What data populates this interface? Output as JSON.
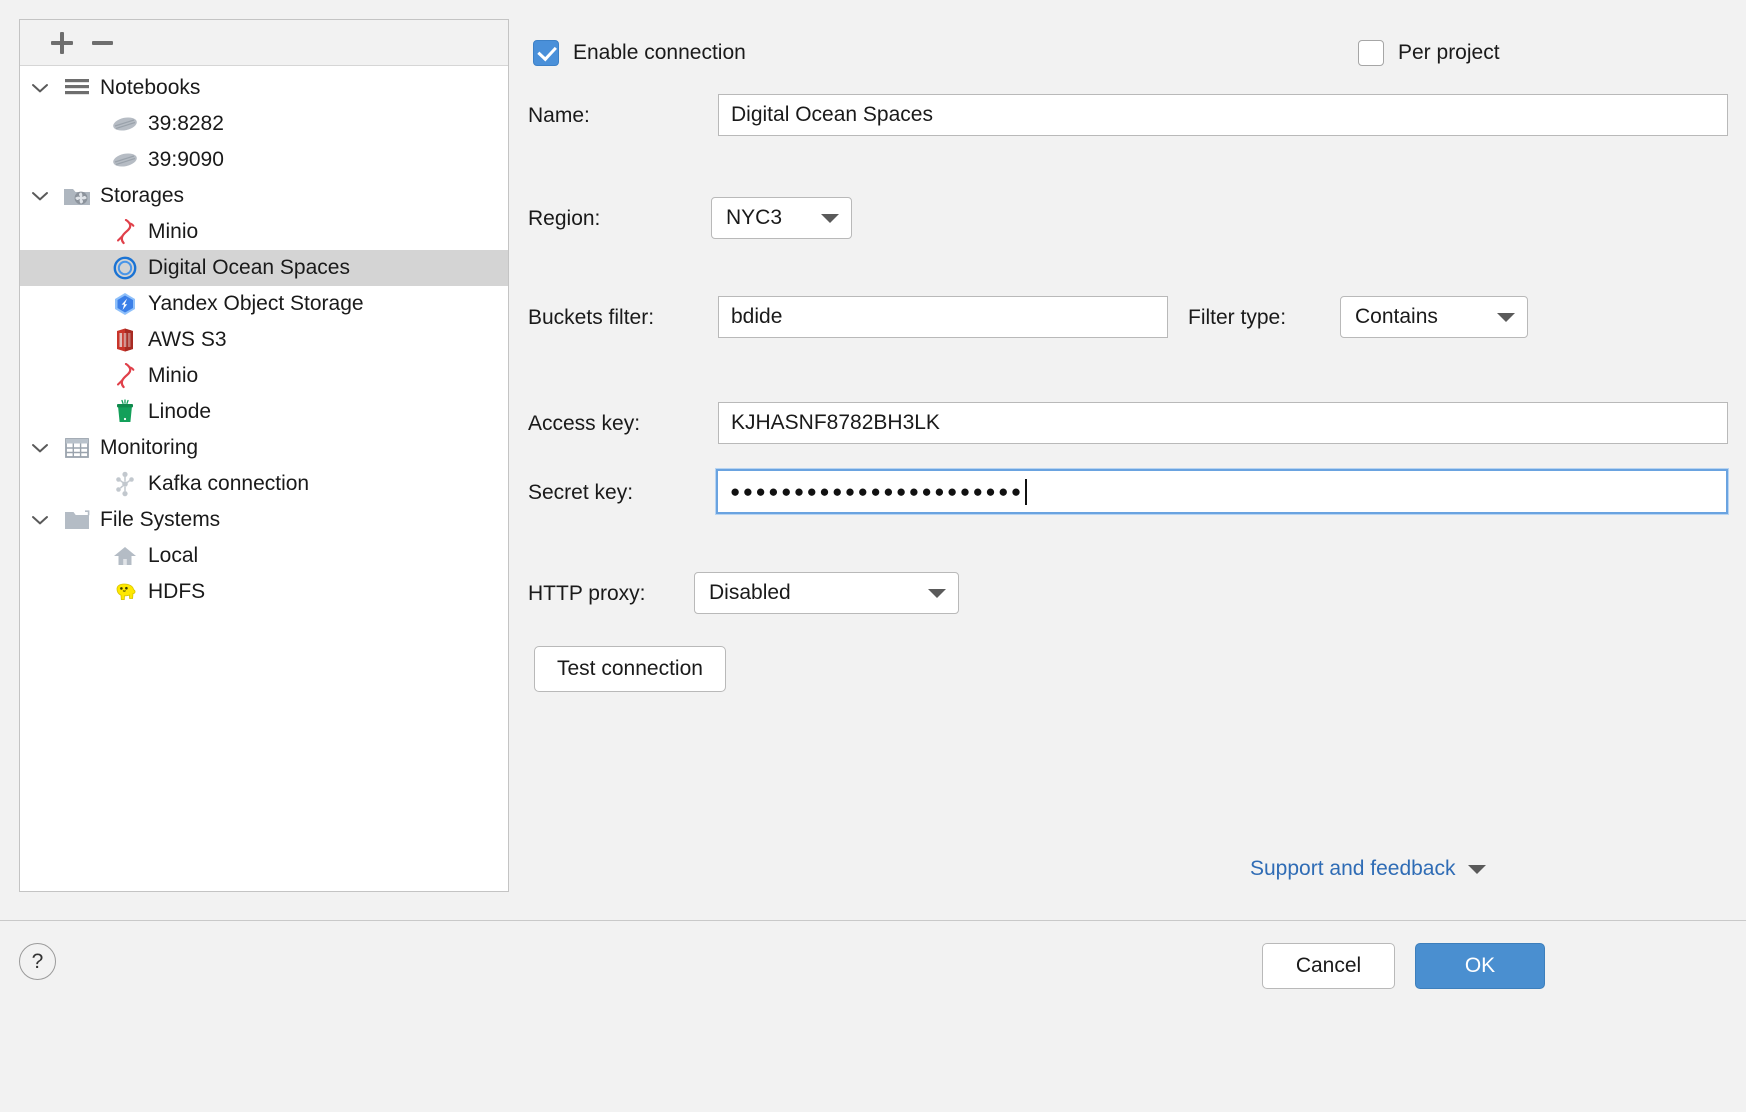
{
  "tree_toolbar": {
    "add_label": "+",
    "remove_label": "−"
  },
  "tree": {
    "items": [
      {
        "label": "Notebooks",
        "depth": 0,
        "icon": "notebooks-icon",
        "expanded": true,
        "selected": false
      },
      {
        "label": "39:8282",
        "depth": 1,
        "icon": "notebook-icon",
        "expanded": null,
        "selected": false
      },
      {
        "label": "39:9090",
        "depth": 1,
        "icon": "notebook-icon",
        "expanded": null,
        "selected": false
      },
      {
        "label": "Storages",
        "depth": 0,
        "icon": "storages-icon",
        "expanded": true,
        "selected": false
      },
      {
        "label": "Minio",
        "depth": 1,
        "icon": "minio-icon",
        "expanded": null,
        "selected": false
      },
      {
        "label": "Digital Ocean Spaces",
        "depth": 1,
        "icon": "digitalocean-icon",
        "expanded": null,
        "selected": true
      },
      {
        "label": "Yandex Object Storage",
        "depth": 1,
        "icon": "yandex-icon",
        "expanded": null,
        "selected": false
      },
      {
        "label": "AWS S3",
        "depth": 1,
        "icon": "aws-s3-icon",
        "expanded": null,
        "selected": false
      },
      {
        "label": "Minio",
        "depth": 1,
        "icon": "minio-icon",
        "expanded": null,
        "selected": false
      },
      {
        "label": "Linode",
        "depth": 1,
        "icon": "linode-icon",
        "expanded": null,
        "selected": false
      },
      {
        "label": "Monitoring",
        "depth": 0,
        "icon": "monitoring-icon",
        "expanded": true,
        "selected": false
      },
      {
        "label": "Kafka connection",
        "depth": 1,
        "icon": "kafka-icon",
        "expanded": null,
        "selected": false
      },
      {
        "label": "File Systems",
        "depth": 0,
        "icon": "folder-icon",
        "expanded": true,
        "selected": false
      },
      {
        "label": "Local",
        "depth": 1,
        "icon": "home-icon",
        "expanded": null,
        "selected": false
      },
      {
        "label": "HDFS",
        "depth": 1,
        "icon": "hdfs-icon",
        "expanded": null,
        "selected": false
      }
    ]
  },
  "form": {
    "enable_connection_label": "Enable connection",
    "enable_connection_checked": true,
    "per_project_label": "Per project",
    "per_project_checked": false,
    "name_label": "Name:",
    "name_value": "Digital Ocean Spaces",
    "region_label": "Region:",
    "region_value": "NYC3",
    "buckets_filter_label": "Buckets filter:",
    "buckets_filter_value": "bdide",
    "filter_type_label": "Filter type:",
    "filter_type_value": "Contains",
    "access_key_label": "Access key:",
    "access_key_value": "KJHASNF8782BH3LK",
    "secret_key_label": "Secret key:",
    "secret_key_value": "●●●●●●●●●●●●●●●●●●●●●●●",
    "http_proxy_label": "HTTP proxy:",
    "http_proxy_value": "Disabled",
    "test_connection_label": "Test connection",
    "support_link_label": "Support and feedback"
  },
  "footer": {
    "help_label": "?",
    "cancel_label": "Cancel",
    "ok_label": "OK"
  },
  "colors": {
    "accent": "#4a8fd0",
    "link": "#2f6cb5",
    "selection": "#d4d4d4",
    "panel_bg": "#f2f2f2"
  }
}
